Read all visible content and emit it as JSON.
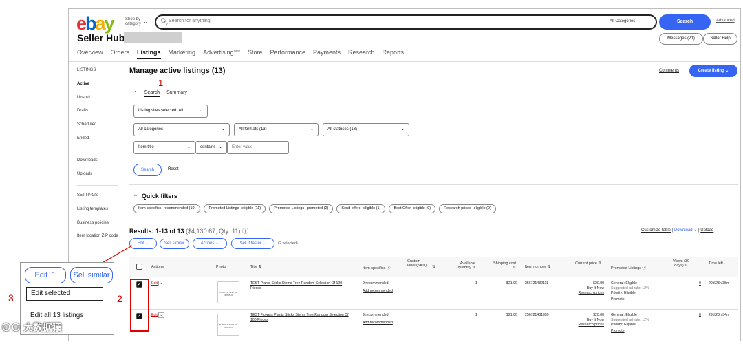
{
  "header": {
    "logo": {
      "e": "e",
      "b": "b",
      "a": "a",
      "y": "y"
    },
    "shop_by": "Shop by category",
    "search_placeholder": "Search for anything",
    "category_select": "All Categories",
    "search_button": "Search",
    "advanced": "Advanced"
  },
  "seller_hub": {
    "title": "Seller Hub",
    "messages": "Messages (21)",
    "help": "Seller Help",
    "nav": [
      "Overview",
      "Orders",
      "Listings",
      "Marketing",
      "Advertising",
      "Store",
      "Performance",
      "Payments",
      "Research",
      "Reports"
    ],
    "advertising_sup": "NEW"
  },
  "sidebar": {
    "listings_heading": "LISTINGS",
    "active": "Active",
    "unsold": "Unsold",
    "drafts": "Drafts",
    "scheduled": "Scheduled",
    "ended": "Ended",
    "downloads": "Downloads",
    "uploads": "Uploads",
    "settings_heading": "SETTINGS",
    "listing_templates": "Listing templates",
    "business_policies": "Business policies",
    "item_location": "Item location ZIP code"
  },
  "main": {
    "title": "Manage active listings (13)",
    "comments": "Comments",
    "create_listing": "Create listing",
    "tabs": {
      "search": "Search",
      "summary": "Summary"
    },
    "sites_filter": "Listing sites selected: All",
    "categories": "All categories",
    "formats": "All formats (13)",
    "statuses": "All statuses (13)",
    "item_title": "Item title",
    "contains": "contains",
    "enter_value": "Enter value",
    "search_btn": "Search",
    "reset": "Reset",
    "quick_filters": "Quick filters",
    "chips": [
      "Item specifics--recommended (10)",
      "Promoted Listings--eligible (11)",
      "Promoted Listings--promoted (2)",
      "Send offers--eligible (1)",
      "Best Offer--eligible (9)",
      "Research prices--eligible (9)"
    ],
    "results": "Results: 1-13 of 13",
    "results_value": "($4,130.67, Qty: 11)",
    "customize": "Customize table",
    "download": "Download",
    "upload": "Upload",
    "bulk": {
      "edit": "Edit",
      "sell_similar": "Sell similar",
      "actions": "Actions",
      "sell_faster": "Sell it faster",
      "selected": "(2 selected)"
    }
  },
  "table": {
    "headers": {
      "actions": "Actions",
      "photo": "Photo",
      "title": "Title",
      "specifics": "Item specifics",
      "sku": "Custom label (SKU)",
      "qty": "Available quantity",
      "shipping": "Shipping cost",
      "item_number": "Item number",
      "price": "Current price",
      "promoted": "Promoted Listings",
      "views": "Views (30 days)",
      "time": "Time left"
    },
    "rows": [
      {
        "edit": "Edit",
        "title": "TEST Plants Sticks Stems Tree Random Selection Of 100 Pieces",
        "photo_text": "THIS IS A TEST DO NOT BUY",
        "specifics": "9 recommended",
        "add_rec": "Add recommended",
        "qty": "1",
        "shipping": "$21.00",
        "item": "256721482118",
        "price": "$20.00",
        "format": "Buy It Now",
        "research": "Research prices",
        "prom1": "General: Eligible",
        "prom2": "Suggested ad rate: 12%",
        "prom3": "Priority: Eligible",
        "promote": "Promote",
        "views": "0",
        "time": "29d 23h 35m"
      },
      {
        "edit": "Edit",
        "title": "TEST Flowers Plants Sticks Stems Tree Random Selection Of 100 Pieces",
        "photo_text": "THIS IS A TEST DO NOT BUY",
        "specifics": "9 recommended",
        "add_rec": "Add recommended",
        "qty": "1",
        "shipping": "$21.00",
        "item": "256721481959",
        "price": "$20.00",
        "format": "Buy It Now",
        "research": "Research prices",
        "prom1": "General: Eligible",
        "prom2": "Suggested ad rate: 12%",
        "prom3": "Priority: Eligible",
        "promote": "Promote",
        "views": "0",
        "time": "29d 23h 34m"
      }
    ]
  },
  "annotations": {
    "n1": "1",
    "n2": "2",
    "n3": "3"
  },
  "popup": {
    "edit": "Edit",
    "sell_similar": "Sell similar",
    "edit_selected": "Edit selected",
    "edit_all": "Edit all 13 listings"
  },
  "watermark": "⊙⊙ 大数据猿"
}
